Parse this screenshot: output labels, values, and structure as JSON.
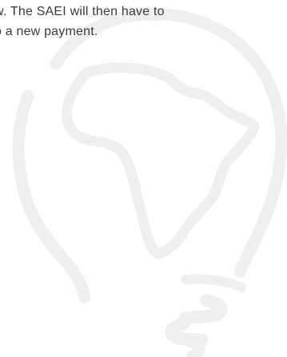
{
  "content": {
    "lines": [
      "w. The SAEI will then have to",
      "o a new payment."
    ]
  },
  "watermark": {
    "icon": "lightbulb-africa-icon",
    "color": "#f0f0f0"
  }
}
